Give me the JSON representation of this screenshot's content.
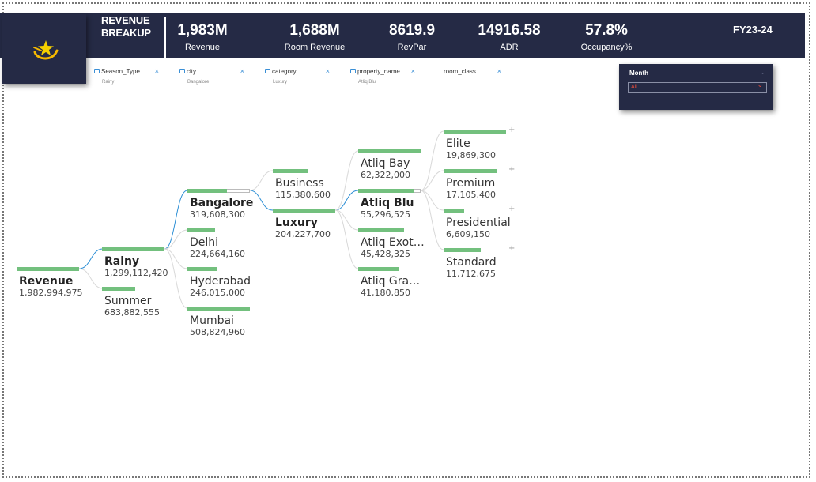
{
  "header": {
    "title_line1": "REVENUE",
    "title_line2": "BREAKUP",
    "fiscal_year": "FY23-24",
    "kpis": [
      {
        "value": "1,983M",
        "label": "Revenue"
      },
      {
        "value": "1,688M",
        "label": "Room Revenue"
      },
      {
        "value": "8619.9",
        "label": "RevPar"
      },
      {
        "value": "14916.58",
        "label": "ADR"
      },
      {
        "value": "57.8%",
        "label": "Occupancy%"
      }
    ]
  },
  "filters": [
    {
      "name": "Season_Type",
      "value": "Rainy",
      "locked": true
    },
    {
      "name": "city",
      "value": "Bangalore",
      "locked": true
    },
    {
      "name": "category",
      "value": "Luxury",
      "locked": true
    },
    {
      "name": "property_name",
      "value": "Atliq Blu",
      "locked": true
    },
    {
      "name": "room_class",
      "value": "",
      "locked": false
    }
  ],
  "slicer": {
    "title": "Month",
    "value": "All"
  },
  "colors": {
    "header_bg": "#252a45",
    "bar": "#73c07e",
    "link": "#2d8fd5",
    "slicer_value": "#e74c3c"
  },
  "tree": {
    "root": {
      "label": "Revenue",
      "value": "1,982,994,975"
    },
    "season": [
      {
        "label": "Rainy",
        "value": "1,299,112,420",
        "fraction": 1.0,
        "selected": true
      },
      {
        "label": "Summer",
        "value": "683,882,555",
        "fraction": 0.53
      }
    ],
    "city": [
      {
        "label": "Bangalore",
        "value": "319,608,300",
        "fraction": 0.63,
        "selected": true
      },
      {
        "label": "Delhi",
        "value": "224,664,160",
        "fraction": 0.44
      },
      {
        "label": "Hyderabad",
        "value": "246,015,000",
        "fraction": 0.48
      },
      {
        "label": "Mumbai",
        "value": "508,824,960",
        "fraction": 1.0
      }
    ],
    "category": [
      {
        "label": "Business",
        "value": "115,380,600",
        "fraction": 0.56
      },
      {
        "label": "Luxury",
        "value": "204,227,700",
        "fraction": 1.0,
        "selected": true
      }
    ],
    "property": [
      {
        "label": "Atliq Bay",
        "value": "62,322,000",
        "fraction": 1.0
      },
      {
        "label": "Atliq Blu",
        "value": "55,296,525",
        "fraction": 0.89,
        "selected": true
      },
      {
        "label": "Atliq Exot…",
        "value": "45,428,325",
        "fraction": 0.73
      },
      {
        "label": "Atliq Gra…",
        "value": "41,180,850",
        "fraction": 0.66
      }
    ],
    "room_class": [
      {
        "label": "Elite",
        "value": "19,869,300",
        "fraction": 1.0
      },
      {
        "label": "Premium",
        "value": "17,105,400",
        "fraction": 0.86
      },
      {
        "label": "Presidential",
        "value": "6,609,150",
        "fraction": 0.33
      },
      {
        "label": "Standard",
        "value": "11,712,675",
        "fraction": 0.59
      }
    ],
    "expand_symbol": "+"
  }
}
